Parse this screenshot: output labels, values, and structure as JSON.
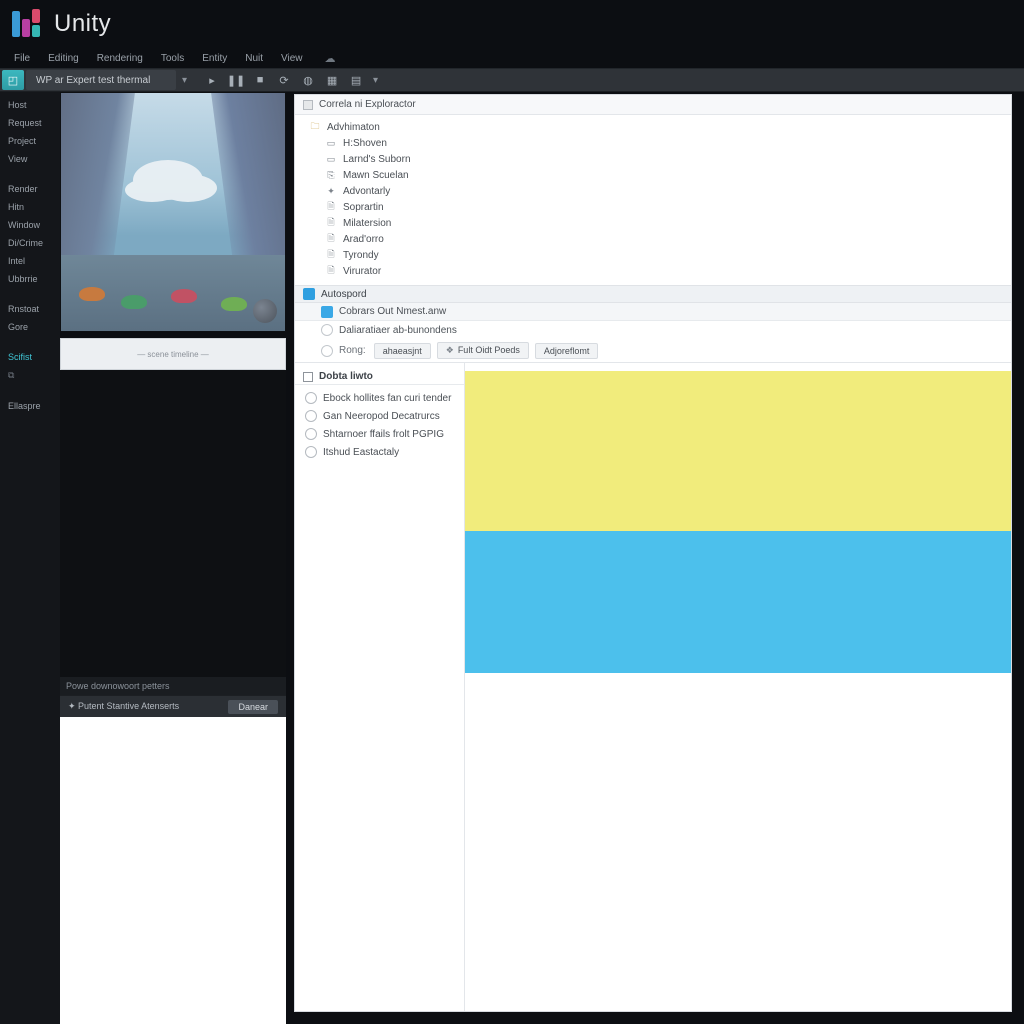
{
  "app": {
    "name": "Unity"
  },
  "menu": [
    "File",
    "Editing",
    "Rendering",
    "Tools",
    "Entity",
    "Nuit",
    "View"
  ],
  "toolbar": {
    "path": "WP ar Expert test thermal",
    "icons": [
      "play-icon",
      "step-icon",
      "pause-icon",
      "sync-icon",
      "globe-icon",
      "cube-icon",
      "grid-icon"
    ]
  },
  "leftrail": {
    "items": [
      "Host",
      "Request",
      "Project",
      "View",
      "Render",
      "Hitn",
      "Window",
      "Di/Crime",
      "Intel",
      "Ubbrrie",
      "Rnstoat",
      "Gore"
    ],
    "active": "Scifist",
    "extra": "Ellaspre"
  },
  "scene": {
    "timeline_label": "— scene timeline —",
    "status": "Powe downowoort petters",
    "asset_label": "✦ Putent Stantive Atenserts",
    "asset_button": "Danear"
  },
  "inspector": {
    "header": "Correla ni Exploractor",
    "tree_root": "Advhimaton",
    "tree": [
      "H:Shoven",
      "Larnd's Suborn",
      "Mawn Scuelan",
      "Advontarly",
      "Soprartin",
      "Milatersion",
      "Arad'orro",
      "Tyrondy",
      "Virurator"
    ],
    "section": "Autospord",
    "component": "Cobrars Out Nmest.anw",
    "prop_extra": "Daliaratiaer ab-bunondens",
    "prop_label": "Rong:",
    "prop_value": "ahaeasjnt",
    "chips": [
      "Fult Oidt Poeds",
      "Adjoreflomt"
    ]
  },
  "outline": {
    "header": "Dobta liwto",
    "rows": [
      "Ebock hollites fan curi tender",
      "Gan Neeropod Decatrurcs",
      "Shtarnoer ffails frolt PGPIG",
      "Itshud Eastactaly"
    ]
  },
  "colors": {
    "yellow": "#f1ec7c",
    "blue": "#4cc0ec"
  }
}
